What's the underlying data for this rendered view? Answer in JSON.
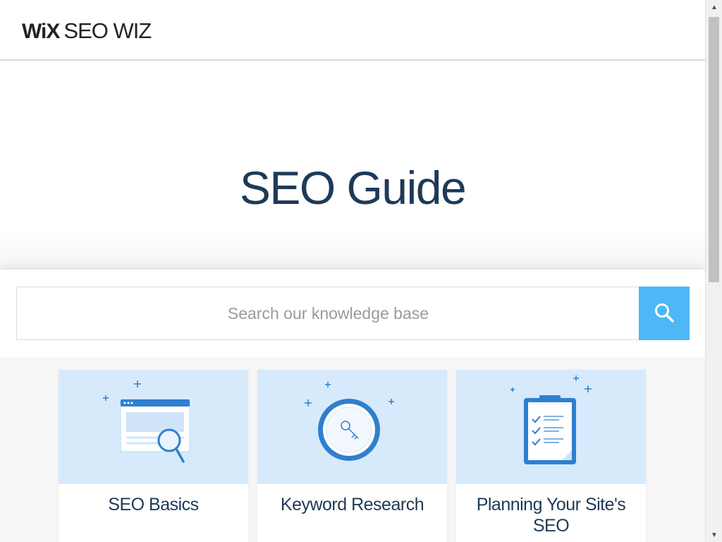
{
  "header": {
    "logo_wix": "WiX",
    "logo_product": "SEO WIZ"
  },
  "hero": {
    "title": "SEO Guide"
  },
  "search": {
    "placeholder": "Search our knowledge base",
    "button_icon": "search-icon"
  },
  "cards": [
    {
      "label": "SEO Basics",
      "icon": "browser-magnifier-icon"
    },
    {
      "label": "Keyword Research",
      "icon": "key-badge-icon"
    },
    {
      "label": "Planning Your Site's SEO",
      "icon": "clipboard-checklist-icon"
    }
  ],
  "colors": {
    "title": "#1d3a58",
    "search_button": "#4eb7f5",
    "card_image_bg": "#d6eafb",
    "icon_blue": "#2f7fd0"
  },
  "scrollbar": {
    "up_arrow": "▲",
    "down_arrow": "▼"
  }
}
